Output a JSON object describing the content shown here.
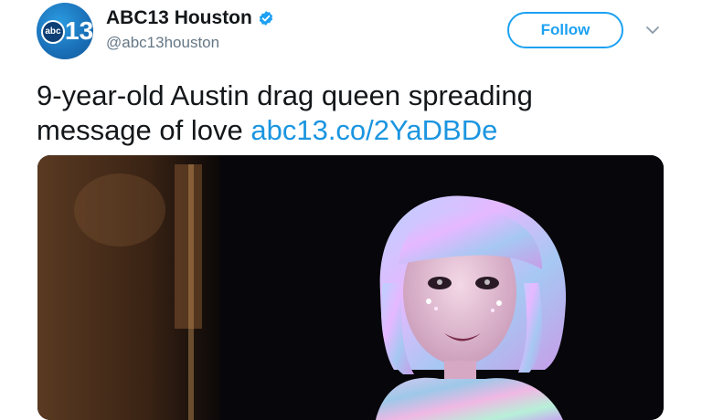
{
  "account": {
    "display_name": "ABC13 Houston",
    "handle": "@abc13houston",
    "avatar_badge": "abc",
    "avatar_number": "13",
    "verified": true
  },
  "actions": {
    "follow_label": "Follow",
    "more_icon": "chevron-down-icon"
  },
  "tweet": {
    "text_line1": "9-year-old Austin drag queen spreading",
    "text_line2_prefix": "message of love ",
    "link": "abc13.co/2YaDBDe"
  },
  "colors": {
    "accent": "#1da1f2",
    "link": "#1b95e0",
    "text": "#14171a",
    "muted": "#657786"
  }
}
